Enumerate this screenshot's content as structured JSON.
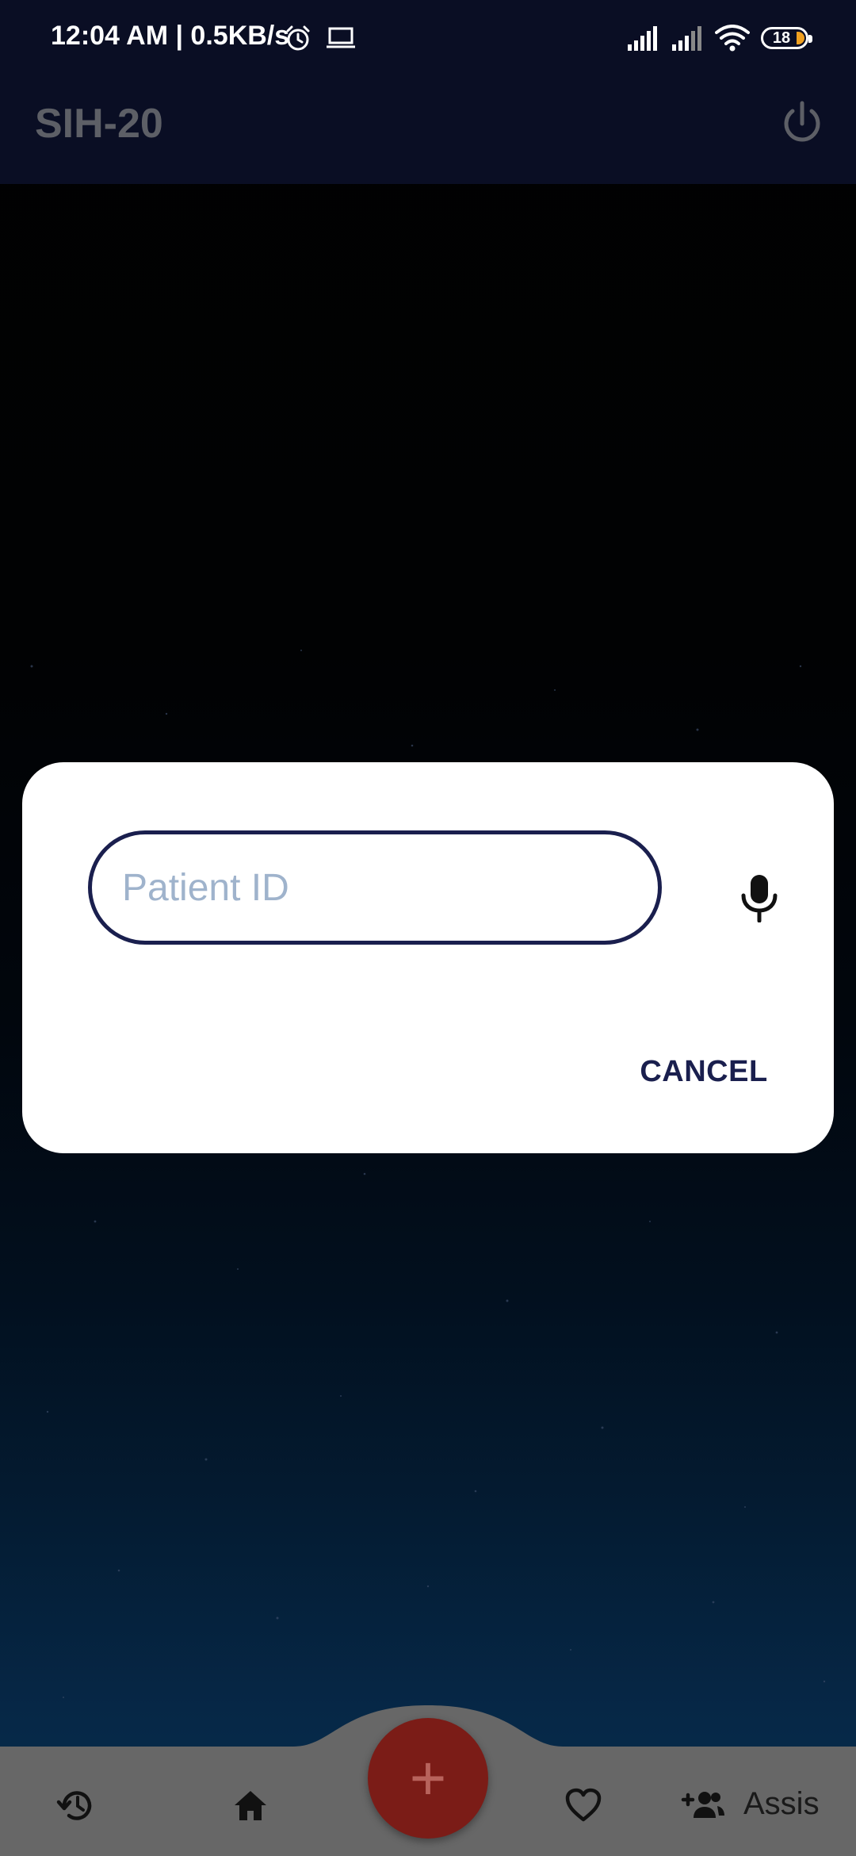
{
  "status_bar": {
    "time_speed": "12:04 AM | 0.5KB/s",
    "battery_level": "18",
    "icons": [
      "alarm-icon",
      "laptop-icon",
      "signal-icon",
      "signal-icon",
      "wifi-icon",
      "battery-icon"
    ]
  },
  "app_bar": {
    "title": "SIH-20",
    "power_icon": "power-icon"
  },
  "dialog": {
    "input_placeholder": "Patient ID",
    "input_value": "",
    "mic_icon": "mic-icon",
    "cancel_label": "CANCEL"
  },
  "bottom_nav": {
    "items": [
      {
        "icon": "history-icon"
      },
      {
        "icon": "home-icon"
      },
      {
        "icon": "heart-icon"
      },
      {
        "icon": "add-person-icon",
        "label": "Assis"
      }
    ],
    "fab_icon": "plus-icon",
    "fab_label": "+"
  },
  "colors": {
    "accent": "#1a1f4e",
    "fab": "#7b1c17",
    "nav_background": "#676767",
    "dialog_background": "#ffffff"
  }
}
